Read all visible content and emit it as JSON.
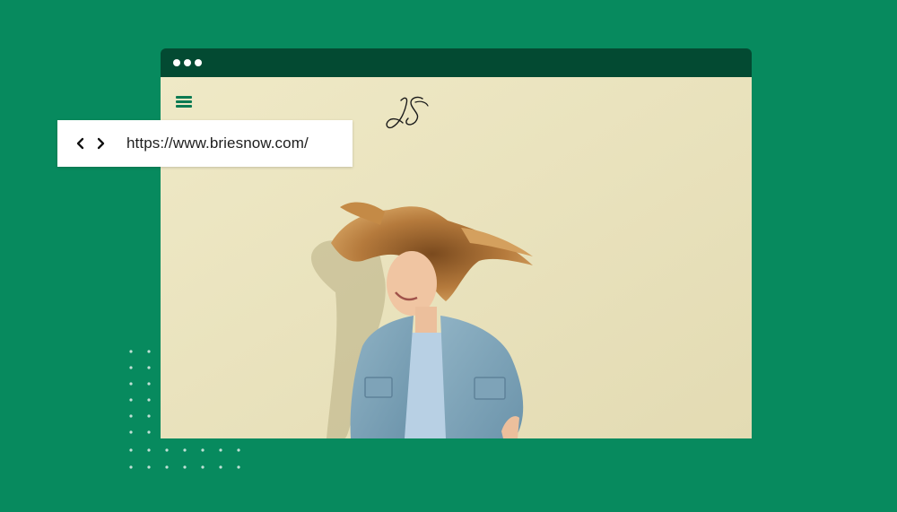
{
  "background_color": "#078a5e",
  "browser_window": {
    "titlebar_color": "#034a32",
    "window_controls": [
      "dot-icon",
      "dot-icon",
      "dot-icon"
    ]
  },
  "website": {
    "menu_icon": "hamburger-menu-icon",
    "logo_text": "JS",
    "hero_image": "woman in denim jacket with windswept hair against cream wall",
    "wall_color": "#ebe5c1"
  },
  "address_bar": {
    "back_icon": "chevron-left-icon",
    "forward_icon": "chevron-right-icon",
    "url": "https://www.briesnow.com/"
  }
}
